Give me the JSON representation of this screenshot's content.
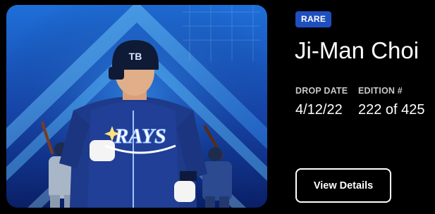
{
  "card": {
    "rarity_badge": "RARE",
    "player_name": "Ji-Man Choi",
    "drop_date_label": "DROP DATE",
    "drop_date": "4/12/22",
    "edition_label": "EDITION #",
    "edition": "222 of 425",
    "view_details_label": "View Details",
    "artwork": {
      "cap_logo": "TB",
      "jersey_text": "RAYS"
    }
  },
  "colors": {
    "badge": "#1f4fbf",
    "background": "#000000",
    "art_blue": "#1a4fb8"
  }
}
